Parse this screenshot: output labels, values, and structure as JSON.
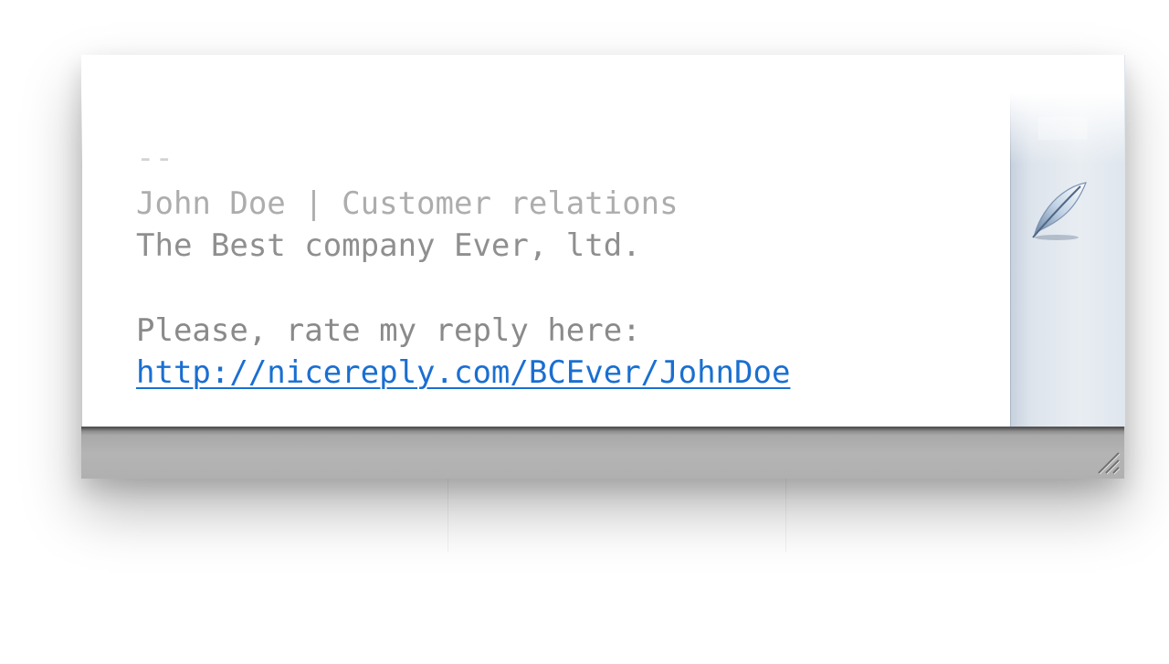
{
  "signature": {
    "separator": "--",
    "name_line": "John Doe | Customer relations",
    "company_line": "The Best company Ever, ltd.",
    "rate_prompt": "Please, rate my reply here:",
    "rate_link": "http://nicereply.com/BCEver/JohnDoe"
  },
  "side_panel": {
    "icons": [
      "button-icon",
      "quill-icon"
    ]
  },
  "colors": {
    "link": "#1a6fd1",
    "text": "#8c8c8c",
    "panel": "#dde4ec",
    "statusbar": "#b4b4b4"
  }
}
